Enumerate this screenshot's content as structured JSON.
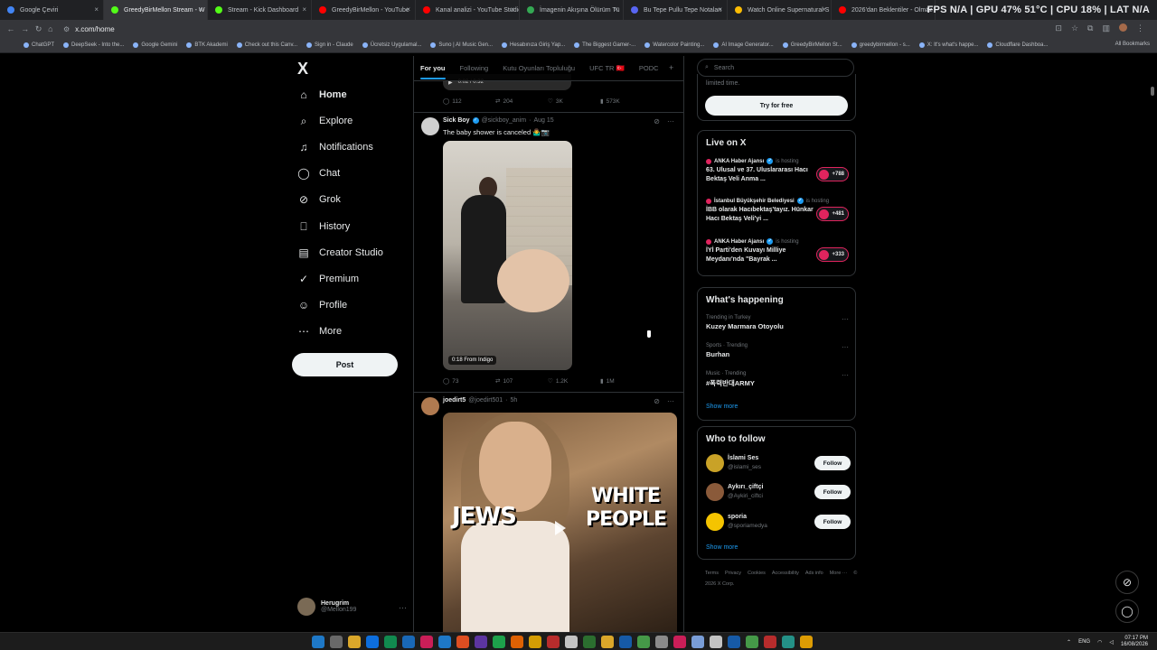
{
  "browser": {
    "tabs": [
      {
        "label": "Google Çeviri",
        "color": "#4285f4"
      },
      {
        "label": "GreedyBirMellon Stream - W",
        "color": "#53fc18",
        "active": true
      },
      {
        "label": "Stream - Kick Dashboard",
        "color": "#53fc18"
      },
      {
        "label": "GreedyBirMellon - YouTube",
        "color": "#ff0000"
      },
      {
        "label": "Kanal analizi - YouTube Studio",
        "color": "#ff0000"
      },
      {
        "label": "İmagenin Akışına Ölürüm Tü",
        "color": "#34a853"
      },
      {
        "label": "Bu Tepe Pullu Tepe Notaları",
        "color": "#5865f2"
      },
      {
        "label": "Watch Online Supernatural S",
        "color": "#fbbc04"
      },
      {
        "label": "2026'dan Beklentiler - Olmaz",
        "color": "#ff0000"
      }
    ],
    "perf_overlay": "FPS N/A | GPU 47% 51°C | CPU 18% | LAT N/A",
    "url": "x.com/home",
    "bookmarks": [
      "ChatGPT",
      "DeepSeek - Into the...",
      "Google Gemini",
      "BTK Akademi",
      "Check out this Canv...",
      "Sign in - Claude",
      "Ücretsiz Uygulamal...",
      "Suno | AI Music Gen...",
      "Hesabınıza Giriş Yap...",
      "The Biggest Gamer-...",
      "Watercolor Painting...",
      "AI Image Generator...",
      "GreedyBirMellon St...",
      "greedybirmellon - s...",
      "X: It's what's happe...",
      "Cloudflare Dashboa..."
    ],
    "all_bookmarks": "All Bookmarks"
  },
  "leftnav": {
    "logo": "X",
    "items": [
      {
        "label": "Home",
        "icon": "⌂"
      },
      {
        "label": "Explore",
        "icon": "⌕"
      },
      {
        "label": "Notifications",
        "icon": "♫"
      },
      {
        "label": "Chat",
        "icon": "◯"
      },
      {
        "label": "Grok",
        "icon": "⊘"
      },
      {
        "label": "History",
        "icon": "⎕"
      },
      {
        "label": "Creator Studio",
        "icon": "▤"
      },
      {
        "label": "Premium",
        "icon": "✓"
      },
      {
        "label": "Profile",
        "icon": "☺"
      },
      {
        "label": "More",
        "icon": "⋯"
      }
    ],
    "post_label": "Post",
    "account": {
      "name": "Herugrim",
      "handle": "@Mellon199"
    }
  },
  "feed": {
    "tabs": [
      "For you",
      "Following",
      "Kutu Oyunları Topluluğu",
      "UFC TR 🇹🇷",
      "PODC"
    ],
    "top_video_time": "0:02 / 0:32",
    "top_actions": {
      "reply": "112",
      "repost": "204",
      "like": "3K",
      "views": "573K"
    },
    "tweet1": {
      "name": "Sick Boy",
      "handle": "@sickboy_anim",
      "time": "Aug 15",
      "text": "The baby shower is canceled 🤷‍♂️📷",
      "video_badge": "0:18  From  Indigo",
      "actions": {
        "reply": "73",
        "repost": "107",
        "like": "1.2K",
        "views": "1M"
      }
    },
    "tweet2": {
      "name": "joedirt5",
      "handle": "@joedirt501",
      "time": "5h",
      "overlay_left": "JEWS",
      "overlay_right_1": "WHITE",
      "overlay_right_2": "PEOPLE"
    }
  },
  "right": {
    "search_placeholder": "Search",
    "promo_text": "limited time.",
    "try_free": "Try for free",
    "live_title": "Live on X",
    "live": [
      {
        "host": "ANKA Haber Ajansı",
        "hosting": "is hosting",
        "title": "63. Ulusal ve 37. Uluslararası Hacı Bektaş Veli Anma ...",
        "count": "+788"
      },
      {
        "host": "İstanbul Büyükşehir Belediyesi",
        "hosting": "is hosting",
        "title": "İBB olarak Hacıbektaş'tayız. Hünkar Hacı Bektaş Veli'yi ...",
        "count": "+481"
      },
      {
        "host": "ANKA Haber Ajansı",
        "hosting": "is hosting",
        "title": "İYİ Parti'den Kuvayı Milliye Meydanı'nda \"Bayrak ...",
        "count": "+333"
      }
    ],
    "happening_title": "What's happening",
    "trends": [
      {
        "ctx": "Trending in Turkey",
        "title": "Kuzey Marmara Otoyolu"
      },
      {
        "ctx": "Sports · Trending",
        "title": "Burhan"
      },
      {
        "ctx": "Music · Trending",
        "title": "#폭력반대ARMY"
      }
    ],
    "show_more": "Show more",
    "follow_title": "Who to follow",
    "follow": [
      {
        "name": "İslami Ses",
        "handle": "@islami_ses",
        "btn": "Follow",
        "color": "#c9a227"
      },
      {
        "name": "Aykırı_çiftçi",
        "handle": "@Aykiri_ciftci",
        "btn": "Follow",
        "color": "#8a5a3a"
      },
      {
        "name": "sporia",
        "handle": "@sporiamedya",
        "btn": "Follow",
        "color": "#f5c400"
      }
    ],
    "footer": [
      "Terms",
      "Privacy",
      "Cookies",
      "Accessibility",
      "Ads info",
      "More ···",
      "© 2026 X Corp."
    ]
  },
  "taskbar": {
    "lang": "ENG",
    "time": "07:17 PM",
    "date": "16/08/2026"
  }
}
